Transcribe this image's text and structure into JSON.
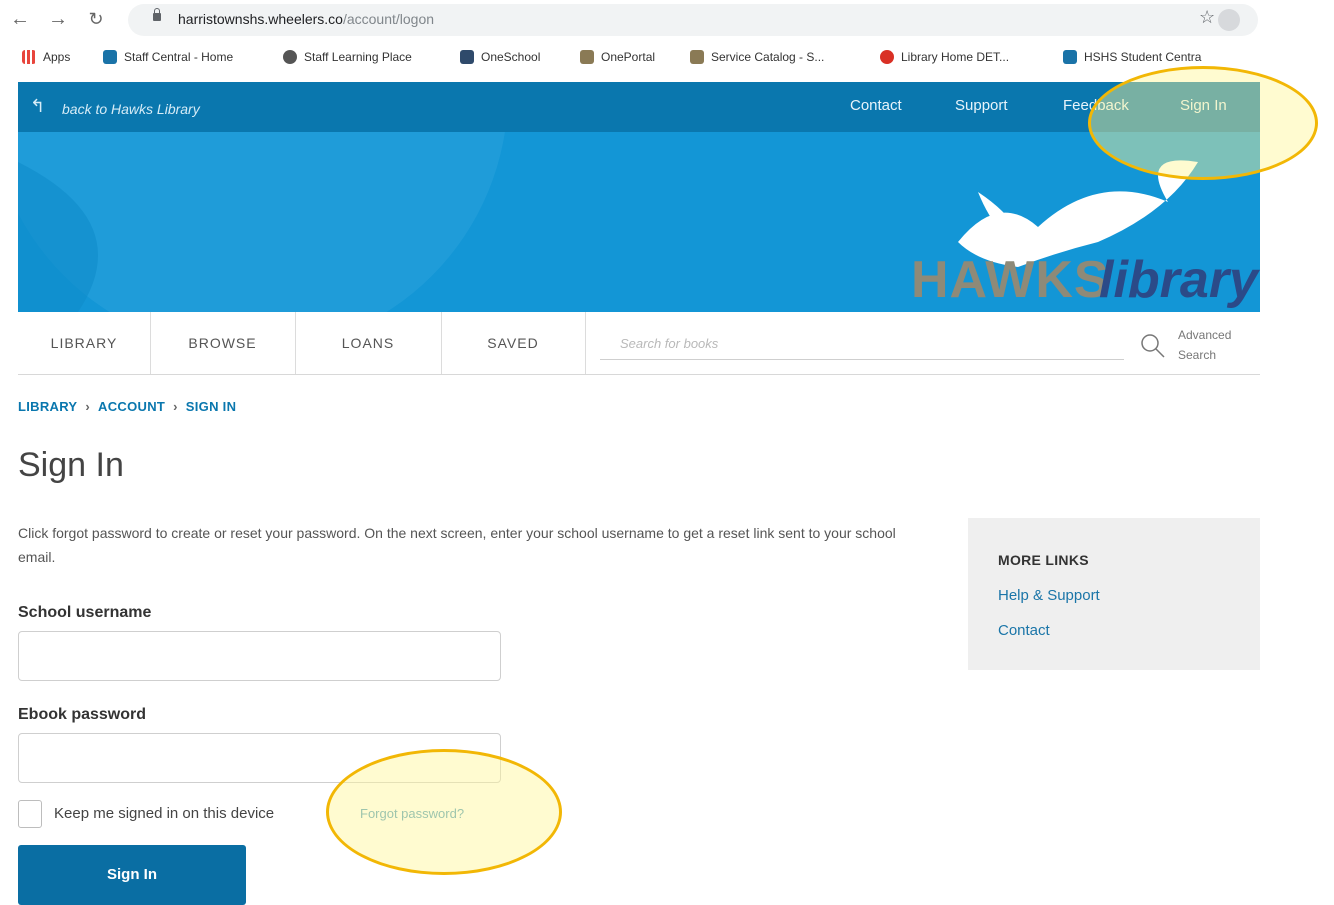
{
  "browser": {
    "url_domain": "harristownshs.wheelers.co",
    "url_path": "/account/logon",
    "bookmarks": [
      {
        "label": "Apps",
        "icon": "apps-grid-icon",
        "color": "#e8453c"
      },
      {
        "label": "Staff Central - Home",
        "icon": "site-icon",
        "color": "#1a73a8"
      },
      {
        "label": "Staff Learning Place",
        "icon": "globe-icon",
        "color": "#555555"
      },
      {
        "label": "OneSchool",
        "icon": "oneschool-icon",
        "color": "#2f4a6b"
      },
      {
        "label": "OnePortal",
        "icon": "crest-icon",
        "color": "#8a7a55"
      },
      {
        "label": "Service Catalog - S...",
        "icon": "crest-icon",
        "color": "#8a7a55"
      },
      {
        "label": "Library Home DET...",
        "icon": "library-icon",
        "color": "#d93025"
      },
      {
        "label": "HSHS Student Centra",
        "icon": "site-icon",
        "color": "#1a73a8"
      }
    ]
  },
  "header": {
    "back_label": "back to Hawks Library",
    "links": [
      "Contact",
      "Support",
      "Feedback",
      "Sign In"
    ],
    "logo_text_a": "HAWKS",
    "logo_text_b": "library"
  },
  "nav": {
    "items": [
      "LIBRARY",
      "BROWSE",
      "LOANS",
      "SAVED"
    ],
    "search_placeholder": "Search for books",
    "advanced_line1": "Advanced",
    "advanced_line2": "Search"
  },
  "breadcrumb": [
    "LIBRARY",
    "ACCOUNT",
    "SIGN IN"
  ],
  "page": {
    "title": "Sign In",
    "intro": "Click forgot password to create or reset your password. On the next screen, enter your school username to get a reset link sent to your school email.",
    "username_label": "School username",
    "password_label": "Ebook password",
    "keep_signed_in": "Keep me signed in on this device",
    "forgot_password": "Forgot password?",
    "submit": "Sign In"
  },
  "sidebar": {
    "title": "MORE LINKS",
    "links": [
      "Help & Support",
      "Contact"
    ]
  },
  "colors": {
    "brand_blue": "#0a77ae",
    "banner_blue": "#1396d6",
    "highlight": "#f2b705"
  }
}
